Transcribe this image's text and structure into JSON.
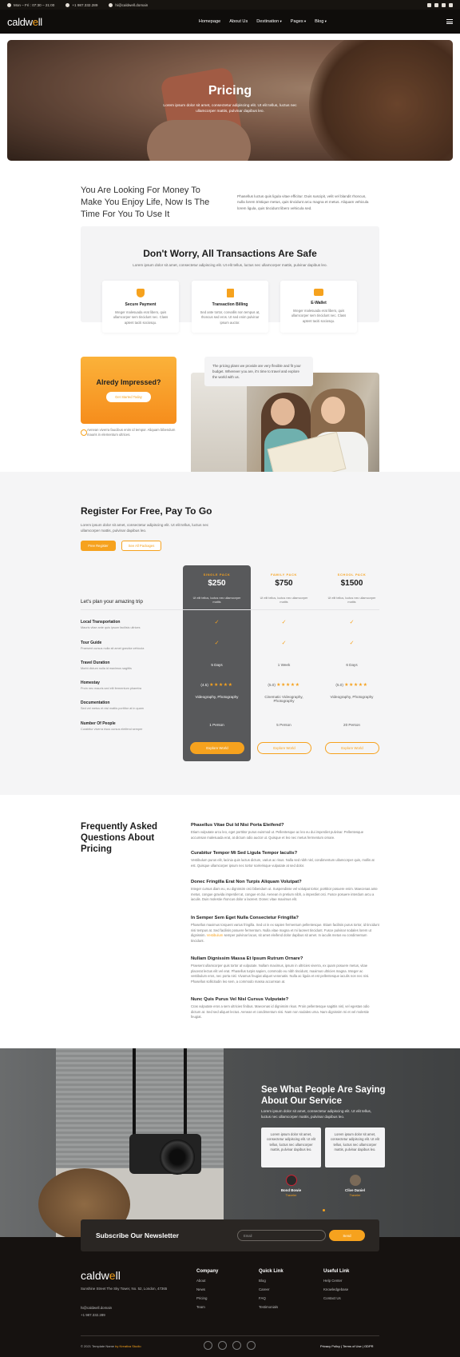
{
  "topbar": {
    "hours": "Mon – Fri : 07:30 – 21:00",
    "phone": "+1 987.332.289",
    "email": "hi@caldwell.domain"
  },
  "brand": {
    "logo_a": "caldw",
    "logo_o": "e",
    "logo_b": "ll",
    "accent": "#f6a21e",
    "dark": "#0f0d0b"
  },
  "nav": {
    "items": [
      "Homepage",
      "About Us",
      "Destination",
      "Pages",
      "Blog"
    ]
  },
  "hero": {
    "title": "Pricing",
    "text": "Lorem ipsum dolor sit amet, consectetur adipiscing elit. Ut elit tellus, luctus nec ullamcorper mattis, pulvinar dapibus leo."
  },
  "intro": {
    "heading": "You Are Looking For Money To Make You Enjoy Life, Now Is The Time For You To Use It",
    "text": "Phasellus luctus quis ligula vitae efficitur. Duis suscipit, velit vel blandit rhoncus, nulla lorem tristique metus, quis tincidunt arcu magna et metus. Aliquam vehicula lorem ligula, quis tincidunt libero vehicula sed."
  },
  "safe": {
    "heading": "Don't Worry, All Transactions Are Safe",
    "text": "Lorem ipsum dolor sit amet, consectetur adipiscing elit. Ut elit tellus, luctus nec ullamcorper mattis, pulvinar dapibus leo.",
    "cards": [
      {
        "title": "Secure Payment",
        "text": "Integer malesuada erat libero, quis ullamcorper sem tincidunt nec. Class aptent taciti sociosqu.",
        "icon": "shield-icon"
      },
      {
        "title": "Transaction Billing",
        "text": "Sed ante tortor, convallis non tempus at, rhoncus sed eros. Ut sed enim pulvinar ipsum auctor.",
        "icon": "billing-icon"
      },
      {
        "title": "E-Wallet",
        "text": "Integer malesuada erat libero, quis ullamcorper sem tincidunt nec. Class aptent taciti sociosqu.",
        "icon": "wallet-icon"
      }
    ]
  },
  "impressed": {
    "heading": "Alredy Impressed?",
    "button": "Get Started Today",
    "note": "Aenean viverra faucibus enim id tempor. Aliquam bibendum mauris in elementum ultrices."
  },
  "bubble": {
    "text": "The pricing plans we provide are very flexible and fit your budget. Wherever you are, it's time to travel and explore the world with us."
  },
  "register": {
    "heading": "Register For Free, Pay To Go",
    "text": "Lorem ipsum dolor sit amet, consectetur adipiscing elit. Ut elit tellus, luctus nec ullamcorper mattis, pulvinar dapibus leo.",
    "btn_free": "Free Register",
    "btn_all": "See All Packages"
  },
  "pricing": {
    "title": "Let's plan your amazing trip",
    "packs": [
      {
        "name": "SINGLE PACK",
        "price": "$250",
        "desc": "Ut elit tellus, luctus nec ullamcorper mattis",
        "duration": "5 Days",
        "score": "(4.5)",
        "stars": "★★★★★",
        "doc": "Videography, Photography",
        "people": "1 Person",
        "button": "Explore World"
      },
      {
        "name": "FAMILY PACK",
        "price": "$750",
        "desc": "Ut elit tellus, luctus nec ullamcorper mattis",
        "duration": "1 Week",
        "score": "(5.0)",
        "stars": "★★★★★",
        "doc": "Cinematic Videography, Photography",
        "people": "5 Person",
        "button": "Explore World"
      },
      {
        "name": "SCHOOL PACK",
        "price": "$1500",
        "desc": "Ut elit tellus, luctus nec ullamcorper mattis",
        "duration": "6 Days",
        "score": "(5.0)",
        "stars": "★★★★★",
        "doc": "Videography, Photography",
        "people": "20 Person",
        "button": "Explore World"
      }
    ],
    "rows": [
      {
        "title": "Local Transportation",
        "sub": "Mauris vitae ante quis ipsum facilisis ultrices"
      },
      {
        "title": "Tour Guide",
        "sub": "Praesent cursus nulla sit amet gravida vehicula"
      },
      {
        "title": "Travel Duration",
        "sub": "Morbi dictum nulla id maximus sagittis"
      },
      {
        "title": "Homestay",
        "sub": "Proin nec mauris sed elit fermentum pharetra"
      },
      {
        "title": "Documentation",
        "sub": "Sed vel metus et nisl mattis porttitor at in quam"
      },
      {
        "title": "Number Of People",
        "sub": "Curabitur viverra risus cursus eleifend semper"
      }
    ]
  },
  "faq": {
    "heading": "Frequently Asked Questions About Pricing",
    "items": [
      {
        "q": "Phasellus Vitae Dui Id Nisi Porta Eleifend?",
        "a": "Etiam vulputate arcu leo, eget porttitor purus euismod ut. Pellentesque ac leo eu dui imperdiet pulvinar. Pellentesque accumsan malesuada erat, at dictum odio auctor ut. Quisque et leo nec metus fermentum ornare."
      },
      {
        "q": "Curabitur Tempor Mi Sed Ligula Tempor Iaculis?",
        "a": "Vestibulum purus elit, lacinia quis luctus dictum, varius ac risus. Nulla sed nibh nisl, condimentum ullamcorper quis, mollis at est. Quisque ullamcorper ipsum nec tortor scelerisque vulputate at sed dolor."
      },
      {
        "q": "Donec Fringilla Erat Non Turpis Aliquam Volutpat?",
        "a": "Integer cursus diam eu, eu dignissim orci bibendum ut. Suspendisse vel volutpat tortor, porttitor posuere enim. Maecenas ante metus, congue gravida imperdiet at, congue et dui. Aenean in pretium nibh, a imperdiet orci. Fusce posuere interdum arcu a iaculis. Duis molestie rhoncus dolor a laoreet. Donec vitae maximus elit."
      },
      {
        "q": "In Semper Sem Eget Nulla Consectetur Fringilla?",
        "a_1": "Phasellus maximus torquent varius fringilla. Sed ut in ex sapien fermentum pellentesque. Etiam facilisis purus tortor, id tincidunt nisi tempus at. Sed facilisis posuere fermentum. Nulla vitae magna et mi laoreet tincidunt. Fusce pulvinar sodales lorem ut dignissim.",
        "a_link": "Vestibulum",
        "a_2": "semper pulvinar lacus, sit amet eleifend dolor dapibus sit amet. In iaculis metus eu condimentum tincidunt."
      },
      {
        "q": "Nullam Dignissim Massa Et Ipsum Rutrum Ornare?",
        "a": "Praesent ullamcorper quis tortor at vulputate. Nullam maximus, ipsum in ultricies viverra, ex quam posuere metus, vitae placerat lectus elit vel erat. Phasellus turpis sapien, commodo eu nibh tincidunt, maximus ultricies magna. Integer ac vestibulum eros, nec porta nisl. Vivamus feugiat aliquet venenatis. Nulla ac ligula et est pellentesque iaculis non nec nisi. Phasellus sollicitudin leo sem, a commodo massa accumsan at."
      },
      {
        "q": "Nunc Quis Purus Vel Nisl Cursus Vulputate?",
        "a": "Cras vulputate eros a sem ultricies finibus. Maecenas id dignissim risus. Proin pellentesque sagittis nisl, vel egestas odio dictum at. Sed sed aliquet lectus. Aenean et condimentum nisi. Nam non sodales urna. Nam dignissim mi et vel molestie feugiat."
      }
    ]
  },
  "testimonials": {
    "heading": "See What People Are Saying About Our Service",
    "text": "Lorem ipsum dolor sit amet, consectetur adipiscing elit. Ut elit tellus, luctus nec ullamcorper mattis, pulvinar dapibus leo.",
    "items": [
      {
        "quote": "Lorem ipsum dolor sit amet, consectetur adipiscing elit. Ut elit tellus, luctus nec ullamcorper mattis, pulvinar dapibus leo.",
        "name": "Bond Bowie",
        "role": "Traveler"
      },
      {
        "quote": "Lorem ipsum dolor sit amet, consectetur adipiscing elit. Ut elit tellus, luctus nec ullamcorper mattis, pulvinar dapibus leo.",
        "name": "Clive Daniel",
        "role": "Traveler"
      }
    ]
  },
  "newsletter": {
    "heading": "Subscribe Our Newsletter",
    "placeholder": "Email",
    "button": "Send"
  },
  "footer": {
    "address": "Sunshine Street The Sky Tower, No. 52, London, 47365",
    "email": "hi@caldwell.domain",
    "phone": "+1 987.332.289",
    "cols": [
      {
        "title": "Company",
        "links": [
          "About",
          "News",
          "Pricing",
          "Team"
        ]
      },
      {
        "title": "Quick Link",
        "links": [
          "Blog",
          "Career",
          "FAQ",
          "Testimonials"
        ]
      },
      {
        "title": "Useful Link",
        "links": [
          "Help Center",
          "Knowledgebase",
          "Contact Us"
        ]
      }
    ],
    "copyright": "© 2021 Template Name",
    "credit": "by Kreativa Studio",
    "legal": [
      "Privacy Policy",
      "Terms of Use",
      "GDPR"
    ]
  }
}
